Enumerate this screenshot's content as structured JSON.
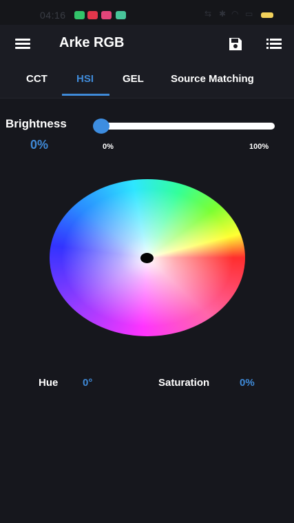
{
  "status_bar": {
    "time": "04:16",
    "app_icons": [
      {
        "name": "app-notification-green",
        "color": "#33c46a"
      },
      {
        "name": "app-notification-red",
        "color": "#e2364b"
      },
      {
        "name": "app-notification-pink",
        "color": "#e3457a"
      },
      {
        "name": "app-notification-teal",
        "color": "#48c49a"
      }
    ],
    "battery_color": "#f2d15b"
  },
  "app_bar": {
    "title": "Arke RGB",
    "icons": [
      "menu-icon",
      "save-icon",
      "list-icon"
    ]
  },
  "tabs": [
    {
      "label": "CCT",
      "active": false
    },
    {
      "label": "HSI",
      "active": true
    },
    {
      "label": "GEL",
      "active": false
    },
    {
      "label": "Source Matching",
      "active": false
    }
  ],
  "brightness": {
    "label": "Brightness",
    "value": "0%",
    "min_label": "0%",
    "max_label": "100%",
    "level": 0
  },
  "hsi": {
    "hue_label": "Hue",
    "hue_value": "0°",
    "saturation_label": "Saturation",
    "saturation_value": "0%"
  },
  "colors": {
    "accent": "#3f8ad8",
    "background": "#16171d",
    "bar": "#1b1c23"
  }
}
